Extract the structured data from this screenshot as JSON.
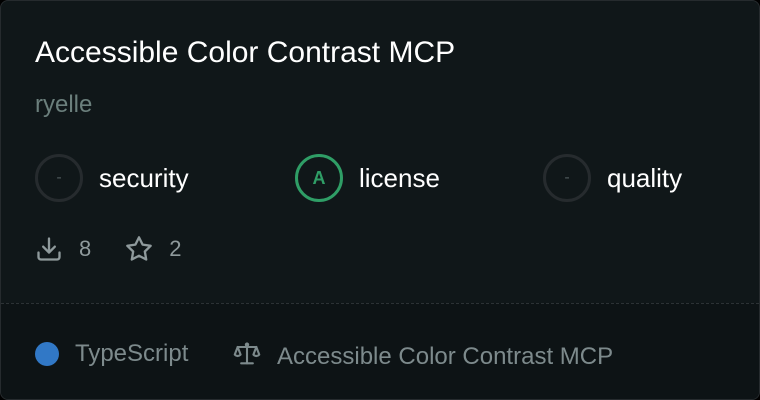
{
  "card": {
    "title": "Accessible Color Contrast MCP",
    "author": "ryelle",
    "scores": [
      {
        "grade": "-",
        "label": "security",
        "status_color": "#262b2e"
      },
      {
        "grade": "A",
        "label": "license",
        "status_color": "#2f9e66"
      },
      {
        "grade": "-",
        "label": "quality",
        "status_color": "#262b2e"
      }
    ],
    "stats": {
      "downloads": {
        "icon": "download-icon",
        "value": "8"
      },
      "stars": {
        "icon": "star-icon",
        "value": "2"
      }
    },
    "footer": {
      "language": {
        "name": "TypeScript",
        "color": "#3178c6"
      },
      "license": {
        "icon": "scale-icon",
        "name": "Accessible Color Contrast MCP"
      }
    }
  }
}
